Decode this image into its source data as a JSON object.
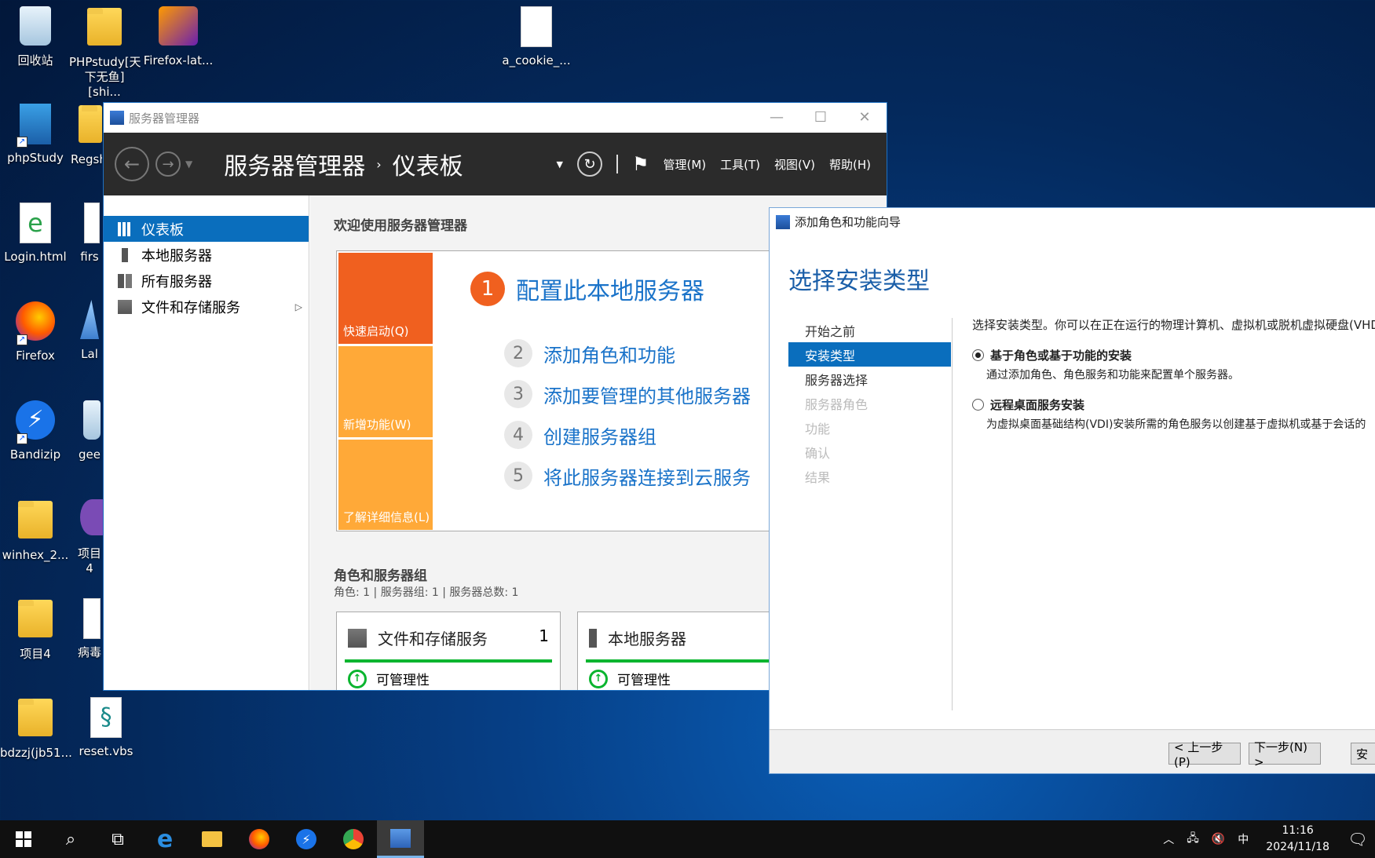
{
  "desktop": {
    "icons": [
      {
        "label": "回收站"
      },
      {
        "label": "PHPstudy[天下无鱼][shi..."
      },
      {
        "label": "Firefox-lat..."
      },
      {
        "label": "a_cookie_..."
      },
      {
        "label": "phpStudy"
      },
      {
        "label": "Regsh"
      },
      {
        "label": "Login.html"
      },
      {
        "label": "firs"
      },
      {
        "label": "Firefox"
      },
      {
        "label": "Lal"
      },
      {
        "label": "Bandizip"
      },
      {
        "label": "gee"
      },
      {
        "label": "winhex_2..."
      },
      {
        "label": "项目4"
      },
      {
        "label": "项目4"
      },
      {
        "label": "病毒"
      },
      {
        "label": "bdzzj(jb51..."
      },
      {
        "label": "reset.vbs"
      }
    ]
  },
  "server_manager": {
    "window_title": "服务器管理器",
    "breadcrumb_root": "服务器管理器",
    "breadcrumb_sep": "›",
    "breadcrumb_current": "仪表板",
    "menus": [
      "管理(M)",
      "工具(T)",
      "视图(V)",
      "帮助(H)"
    ],
    "sidebar": [
      {
        "label": "仪表板"
      },
      {
        "label": "本地服务器"
      },
      {
        "label": "所有服务器"
      },
      {
        "label": "文件和存储服务"
      }
    ],
    "welcome": "欢迎使用服务器管理器",
    "tiles": [
      "快速启动(Q)",
      "新增功能(W)",
      "了解详细信息(L)"
    ],
    "steps": [
      {
        "num": "1",
        "label": "配置此本地服务器"
      },
      {
        "num": "2",
        "label": "添加角色和功能"
      },
      {
        "num": "3",
        "label": "添加要管理的其他服务器"
      },
      {
        "num": "4",
        "label": "创建服务器组"
      },
      {
        "num": "5",
        "label": "将此服务器连接到云服务"
      }
    ],
    "roles_title": "角色和服务器组",
    "roles_summary": "角色: 1 | 服务器组: 1 | 服务器总数: 1",
    "cards": [
      {
        "title": "文件和存储服务",
        "count": "1",
        "status": "可管理性"
      },
      {
        "title": "本地服务器",
        "count": "",
        "status": "可管理性"
      }
    ]
  },
  "wizard": {
    "window_title": "添加角色和功能向导",
    "heading": "选择安装类型",
    "steps": [
      {
        "label": "开始之前",
        "state": "done"
      },
      {
        "label": "安装类型",
        "state": "active"
      },
      {
        "label": "服务器选择",
        "state": "done"
      },
      {
        "label": "服务器角色",
        "state": "future"
      },
      {
        "label": "功能",
        "state": "future"
      },
      {
        "label": "确认",
        "state": "future"
      },
      {
        "label": "结果",
        "state": "future"
      }
    ],
    "description": "选择安装类型。你可以在正在运行的物理计算机、虚拟机或脱机虚拟硬盘(VHD)上",
    "options": [
      {
        "label": "基于角色或基于功能的安装",
        "desc": "通过添加角色、角色服务和功能来配置单个服务器。",
        "selected": true
      },
      {
        "label": "远程桌面服务安装",
        "desc": "为虚拟桌面基础结构(VDI)安装所需的角色服务以创建基于虚拟机或基于会话的",
        "selected": false
      }
    ],
    "buttons": {
      "prev": "< 上一步(P)",
      "next": "下一步(N) >",
      "install": "安"
    }
  },
  "taskbar": {
    "ime": "中",
    "time": "11:16",
    "date": "2024/11/18"
  },
  "colors": {
    "accent": "#0a6ebd",
    "orange": "#f0601f",
    "tile": "#ffa938",
    "link": "#1a73c9"
  }
}
